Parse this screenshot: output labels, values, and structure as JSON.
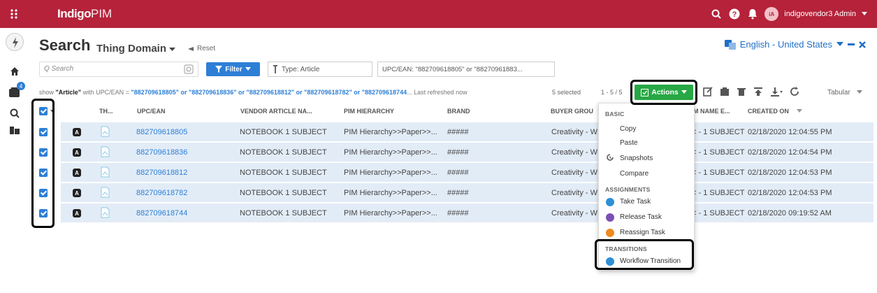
{
  "header": {
    "brand_bold": "Indigo",
    "brand_light": "PIM",
    "username": "indigovendor3 Admin",
    "avatar_initials": "iA"
  },
  "page": {
    "title": "Search",
    "domain": "Thing Domain",
    "reset_label": "Reset",
    "language": "English - United States"
  },
  "toolbar": {
    "search_placeholder": "Q  Search",
    "filter_label": "Filter",
    "chip_type": "Type: Article",
    "chip_upc": "UPC/EAN: \"882709618805\" or \"88270961883..."
  },
  "info": {
    "prefix": "show ",
    "entity": "\"Article\"",
    "mid": " with UPC/EAN = ",
    "query": "\"882709618805\" or \"882709618836\" or \"882709618812\" or \"882709618782\" or \"882709618744",
    "suffix": "... Last refreshed now",
    "selected": "5 selected",
    "pager": "1 - 5 / 5",
    "actions_label": "Actions",
    "view": "Tabular"
  },
  "table": {
    "headers": [
      "TH...",
      "UPC/EAN",
      "VENDOR ARTICLE NA...",
      "PIM HIERARCHY",
      "BRAND",
      "BUYER GROU",
      "M NAME E...",
      "CREATED ON"
    ],
    "rows": [
      {
        "upc": "882709618805",
        "vendor": "NOTEBOOK 1 SUBJECT",
        "hier": "PIM Hierarchy>>Paper>>...",
        "brand": "#####",
        "buyer": "Creativity - W",
        "name": "< - 1 SUBJECT",
        "created": "02/18/2020 12:04:55 PM"
      },
      {
        "upc": "882709618836",
        "vendor": "NOTEBOOK 1 SUBJECT",
        "hier": "PIM Hierarchy>>Paper>>...",
        "brand": "#####",
        "buyer": "Creativity - W",
        "name": "< - 1 SUBJECT",
        "created": "02/18/2020 12:04:54 PM"
      },
      {
        "upc": "882709618812",
        "vendor": "NOTEBOOK 1 SUBJECT",
        "hier": "PIM Hierarchy>>Paper>>...",
        "brand": "#####",
        "buyer": "Creativity - W",
        "name": "< - 1 SUBJECT",
        "created": "02/18/2020 12:04:53 PM"
      },
      {
        "upc": "882709618782",
        "vendor": "NOTEBOOK 1 SUBJECT",
        "hier": "PIM Hierarchy>>Paper>>...",
        "brand": "#####",
        "buyer": "Creativity - W",
        "name": "< - 1 SUBJECT",
        "created": "02/18/2020 12:04:53 PM"
      },
      {
        "upc": "882709618744",
        "vendor": "NOTEBOOK 1 SUBJECT",
        "hier": "PIM Hierarchy>>Paper>>...",
        "brand": "#####",
        "buyer": "Creativity - W",
        "name": "< - 1 SUBJECT",
        "created": "02/18/2020 09:19:52 AM"
      }
    ]
  },
  "menu": {
    "basic": "BASIC",
    "copy": "Copy",
    "paste": "Paste",
    "snapshots": "Snapshots",
    "compare": "Compare",
    "assignments": "ASSIGNMENTS",
    "take_task": "Take Task",
    "release_task": "Release Task",
    "reassign_task": "Reassign Task",
    "transitions": "TRANSITIONS",
    "workflow_transition": "Workflow Transition"
  },
  "colors": {
    "brand": "#b5223a",
    "accent": "#2d7fd6",
    "actions": "#27a844"
  }
}
